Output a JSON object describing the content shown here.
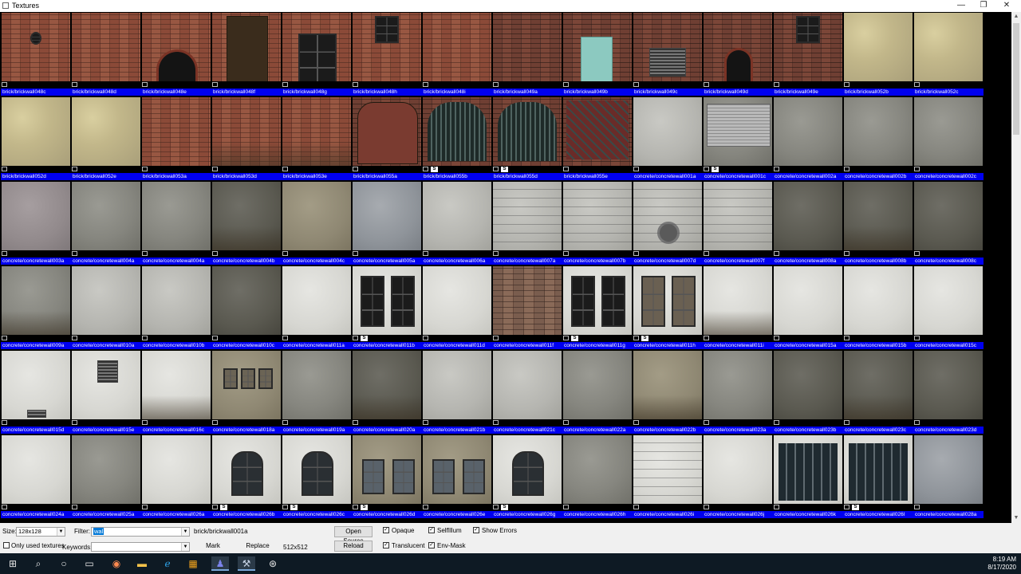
{
  "window": {
    "title": "Textures",
    "minimize_glyph": "—",
    "maximize_glyph": "❐",
    "close_glyph": "✕",
    "icon": "app-window-icon"
  },
  "grid": {
    "badge_text": "S",
    "tiles": [
      {
        "label": "brick/brickwall048c",
        "style": "brick",
        "overlay": "small-window"
      },
      {
        "label": "brick/brickwall048d",
        "style": "brick",
        "overlay": ""
      },
      {
        "label": "brick/brickwall048e",
        "style": "brick",
        "overlay": "arch"
      },
      {
        "label": "brick/brickwall048f",
        "style": "brick",
        "overlay": "door"
      },
      {
        "label": "brick/brickwall048g",
        "style": "brick",
        "overlay": "window"
      },
      {
        "label": "brick/brickwall048h",
        "style": "brick",
        "overlay": "small-window-top"
      },
      {
        "label": "brick/brickwall048i",
        "style": "brick",
        "overlay": ""
      },
      {
        "label": "brick/brickwall049a",
        "style": "brickdark",
        "overlay": ""
      },
      {
        "label": "brick/brickwall049b",
        "style": "brickdark",
        "overlay": "teal-door"
      },
      {
        "label": "brick/brickwall049c",
        "style": "brickdark",
        "overlay": "vent-dark"
      },
      {
        "label": "brick/brickwall049d",
        "style": "brickdark",
        "overlay": "arch-door"
      },
      {
        "label": "brick/brickwall049e",
        "style": "brickdark",
        "overlay": "small-window-top"
      },
      {
        "label": "brick/brickwall052b",
        "style": "plasteryellow",
        "overlay": ""
      },
      {
        "label": "brick/brickwall052c",
        "style": "plasteryellow",
        "overlay": ""
      },
      {
        "label": "brick/brickwall052d",
        "style": "plasteryellow",
        "overlay": ""
      },
      {
        "label": "brick/brickwall052e",
        "style": "plasteryellow",
        "overlay": ""
      },
      {
        "label": "brick/brickwall053a",
        "style": "brick",
        "overlay": ""
      },
      {
        "label": "brick/brickwall053d",
        "style": "brick",
        "overlay": "stain"
      },
      {
        "label": "brick/brickwall053e",
        "style": "brick",
        "overlay": "stain"
      },
      {
        "label": "brick/brickwall055a",
        "style": "brickdark",
        "overlay": "panel"
      },
      {
        "label": "brick/brickwall055b",
        "style": "brickdark",
        "overlay": "gate",
        "badge": true
      },
      {
        "label": "brick/brickwall055d",
        "style": "brickdark",
        "overlay": "gate",
        "badge": true
      },
      {
        "label": "brick/brickwall055e",
        "style": "brickdark",
        "overlay": "lattice"
      },
      {
        "label": "concrete/concretewall001a",
        "style": "concretelight",
        "overlay": ""
      },
      {
        "label": "concrete/concretewall001c",
        "style": "concrete",
        "overlay": "shutter",
        "badge": true
      },
      {
        "label": "concrete/concretewall002a",
        "style": "concrete",
        "overlay": ""
      },
      {
        "label": "concrete/concretewall002b",
        "style": "concrete",
        "overlay": ""
      },
      {
        "label": "concrete/concretewall002c",
        "style": "concrete",
        "overlay": ""
      },
      {
        "label": "concrete/concretewall003a",
        "style": "concretepurple",
        "overlay": ""
      },
      {
        "label": "concrete/concretewall004a",
        "style": "concrete",
        "overlay": ""
      },
      {
        "label": "concrete/concretewall004a",
        "style": "concrete",
        "overlay": ""
      },
      {
        "label": "concrete/concretewall004b",
        "style": "concretedark",
        "overlay": "stain"
      },
      {
        "label": "concrete/concretewall004c",
        "style": "concretetan",
        "overlay": ""
      },
      {
        "label": "concrete/concretewall005a",
        "style": "concreteblue",
        "overlay": ""
      },
      {
        "label": "concrete/concretewall006a",
        "style": "concretelight",
        "overlay": ""
      },
      {
        "label": "concrete/concretewall007a",
        "style": "concretelight",
        "overlay": "lines"
      },
      {
        "label": "concrete/concretewall007b",
        "style": "concretelight",
        "overlay": "lines"
      },
      {
        "label": "concrete/concretewall007d",
        "style": "concretelight",
        "overlay": "circle"
      },
      {
        "label": "concrete/concretewall007f",
        "style": "concretelight",
        "overlay": "lines"
      },
      {
        "label": "concrete/concretewall008a",
        "style": "concretedark",
        "overlay": ""
      },
      {
        "label": "concrete/concretewall008b",
        "style": "concretedark",
        "overlay": "stain"
      },
      {
        "label": "concrete/concretewall008c",
        "style": "concretedark",
        "overlay": ""
      },
      {
        "label": "concrete/concretewall009a",
        "style": "concrete",
        "overlay": "stain"
      },
      {
        "label": "concrete/concretewall010a",
        "style": "concretelight",
        "overlay": ""
      },
      {
        "label": "concrete/concretewall010b",
        "style": "concretelight",
        "overlay": ""
      },
      {
        "label": "concrete/concretewall010c",
        "style": "concretedark",
        "overlay": ""
      },
      {
        "label": "concrete/concretewall011a",
        "style": "white",
        "overlay": ""
      },
      {
        "label": "concrete/concretewall011b",
        "style": "white",
        "overlay": "window2",
        "badge": true
      },
      {
        "label": "concrete/concretewall011d",
        "style": "white",
        "overlay": ""
      },
      {
        "label": "concrete/concretewall011f",
        "style": "brickold",
        "overlay": ""
      },
      {
        "label": "concrete/concretewall011g",
        "style": "white",
        "overlay": "window2",
        "badge": true
      },
      {
        "label": "concrete/concretewall011h",
        "style": "white",
        "overlay": "window2b",
        "badge": true
      },
      {
        "label": "concrete/concretewall011i",
        "style": "white",
        "overlay": "stain"
      },
      {
        "label": "concrete/concretewall015a",
        "style": "white",
        "overlay": ""
      },
      {
        "label": "concrete/concretewall015b",
        "style": "white",
        "overlay": ""
      },
      {
        "label": "concrete/concretewall015c",
        "style": "white",
        "overlay": ""
      },
      {
        "label": "concrete/concretewall015d",
        "style": "white",
        "overlay": "vent-small"
      },
      {
        "label": "concrete/concretewall015e",
        "style": "white",
        "overlay": "vent-top"
      },
      {
        "label": "concrete/concretewall016c",
        "style": "white",
        "overlay": "stain"
      },
      {
        "label": "concrete/concretewall018a",
        "style": "concretetan",
        "overlay": "arches"
      },
      {
        "label": "concrete/concretewall019a",
        "style": "concrete",
        "overlay": ""
      },
      {
        "label": "concrete/concretewall020a",
        "style": "concretedark",
        "overlay": "stain"
      },
      {
        "label": "concrete/concretewall021b",
        "style": "concretelight",
        "overlay": ""
      },
      {
        "label": "concrete/concretewall021c",
        "style": "concretelight",
        "overlay": ""
      },
      {
        "label": "concrete/concretewall022a",
        "style": "concrete",
        "overlay": ""
      },
      {
        "label": "concrete/concretewall022b",
        "style": "concretetan",
        "overlay": "stain"
      },
      {
        "label": "concrete/concretewall023a",
        "style": "concrete",
        "overlay": ""
      },
      {
        "label": "concrete/concretewall023b",
        "style": "concretedark",
        "overlay": ""
      },
      {
        "label": "concrete/concretewall023c",
        "style": "concretedark",
        "overlay": "stain"
      },
      {
        "label": "concrete/concretewall023d",
        "style": "concretedark",
        "overlay": ""
      },
      {
        "label": "concrete/concretewall024a",
        "style": "white",
        "overlay": ""
      },
      {
        "label": "concrete/concretewall025a",
        "style": "concrete",
        "overlay": ""
      },
      {
        "label": "concrete/concretewall026a",
        "style": "white",
        "overlay": ""
      },
      {
        "label": "concrete/concretewall026b",
        "style": "white",
        "overlay": "arch-window",
        "badge": true
      },
      {
        "label": "concrete/concretewall026c",
        "style": "white",
        "overlay": "arch-window",
        "badge": true
      },
      {
        "label": "concrete/concretewall026d",
        "style": "concretetan",
        "overlay": "twin-window",
        "badge": true
      },
      {
        "label": "concrete/concretewall026e",
        "style": "concretetan",
        "overlay": "twin-window"
      },
      {
        "label": "concrete/concretewall026g",
        "style": "white",
        "overlay": "arch-window",
        "badge": true
      },
      {
        "label": "concrete/concretewall026h",
        "style": "concrete",
        "overlay": ""
      },
      {
        "label": "concrete/concretewall026i",
        "style": "white",
        "overlay": "lines"
      },
      {
        "label": "concrete/concretewall026j",
        "style": "white",
        "overlay": ""
      },
      {
        "label": "concrete/concretewall026k",
        "style": "white",
        "overlay": "dark-grid"
      },
      {
        "label": "concrete/concretewall026l",
        "style": "white",
        "overlay": "dark-grid",
        "badge": true
      },
      {
        "label": "concrete/concretewall028a",
        "style": "concreteblue",
        "overlay": ""
      }
    ]
  },
  "toolbar": {
    "size_label": "Size:",
    "size_value": "128x128",
    "filter_label": "Filter:",
    "filter_value": "wal",
    "current_texture": "brick/brickwall001a",
    "open_source": "Open Source",
    "only_used_label": "Only used textures",
    "keywords_label": "Keywords:",
    "keywords_value": "",
    "mark": "Mark",
    "replace": "Replace",
    "dimensions": "512x512",
    "reload": "Reload",
    "opaque": "Opaque",
    "translucent": "Translucent",
    "selfillum": "SelfIllum",
    "envmask": "Env-Mask",
    "show_errors": "Show Errors",
    "checkmark": "✓",
    "dropdown_glyph": "▼"
  },
  "taskbar": {
    "time": "8:19 AM",
    "date": "8/17/2020",
    "icons": [
      "windows-start-icon",
      "search-icon",
      "cortana-icon",
      "task-view-icon",
      "browser-icon",
      "file-explorer-icon",
      "edge-icon",
      "store-icon",
      "teams-icon",
      "hammer-editor-icon",
      "steam-icon"
    ]
  },
  "colors": {
    "label_bg": "#0000f0",
    "grid_bg": "#000000",
    "taskbar_bg": "#0e1a24",
    "toolbar_bg": "#f0f0f0"
  }
}
